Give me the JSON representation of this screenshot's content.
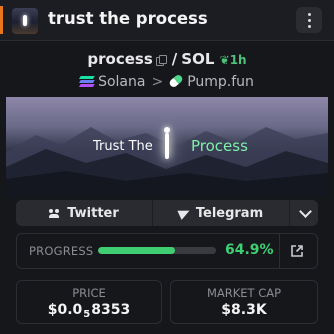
{
  "header": {
    "title": "trust the process",
    "accent_color": "#e8761b"
  },
  "pair": {
    "base": "process",
    "separator": "/",
    "quote": "SOL",
    "age": "1h",
    "age_color": "#4fc27a"
  },
  "chain": {
    "network": "Solana",
    "separator": ">",
    "dex": "Pump.fun"
  },
  "banner": {
    "text_left": "Trust The",
    "text_right": "Process",
    "text_right_color": "#7ff0a8"
  },
  "socials": {
    "twitter_label": "Twitter",
    "telegram_label": "Telegram"
  },
  "progress": {
    "label": "PROGRESS",
    "value_text": "64.9%",
    "fraction": 0.649,
    "color": "#3fcf72"
  },
  "stats": {
    "price_label": "PRICE",
    "price_prefix": "$0.0",
    "price_zeros": "5",
    "price_digits": "8353",
    "mcap_label": "MARKET CAP",
    "mcap_value": "$8.3K"
  }
}
